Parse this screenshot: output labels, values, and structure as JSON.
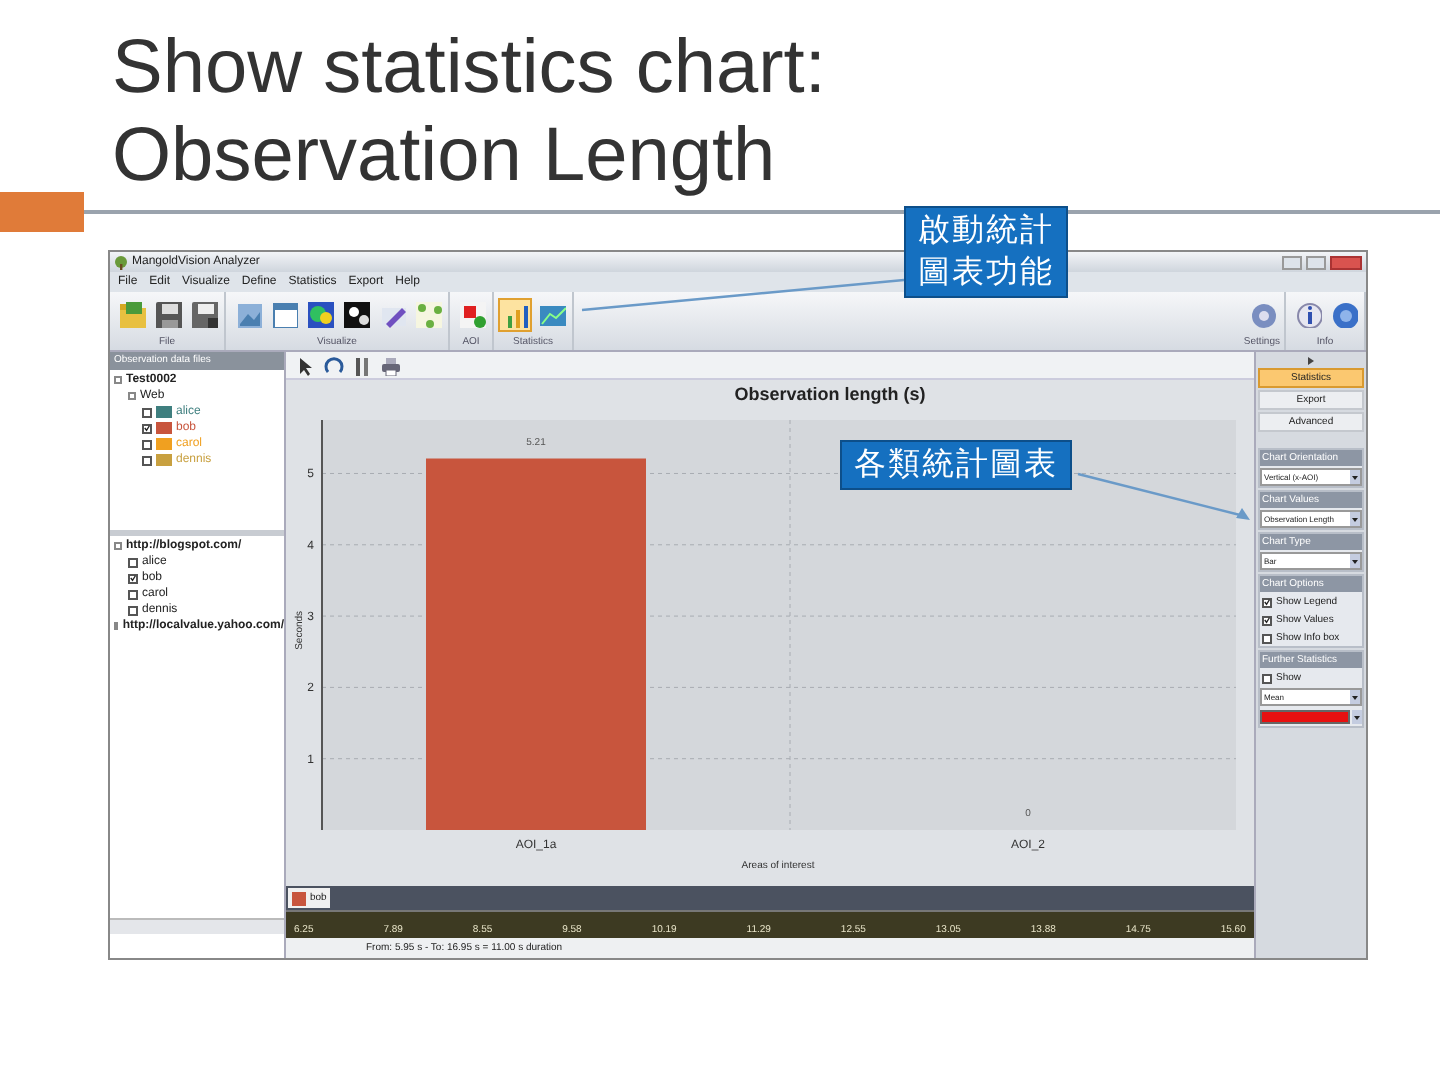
{
  "slide": {
    "title_lines": [
      "Show statistics chart:",
      "Observation Length"
    ]
  },
  "callouts": [
    {
      "text_lines": [
        "啟動統計",
        "圖表功能"
      ]
    },
    {
      "text_lines": [
        "各類統計圖表"
      ]
    }
  ],
  "window": {
    "title": "MangoldVision Analyzer"
  },
  "menu": [
    "File",
    "Edit",
    "Visualize",
    "Define",
    "Statistics",
    "Export",
    "Help"
  ],
  "ribbon": {
    "groups": [
      {
        "label": "File",
        "buttons": [
          {
            "selected": false
          },
          {
            "selected": false
          },
          {
            "selected": false
          }
        ]
      },
      {
        "label": "Visualize",
        "buttons": [
          {
            "selected": false
          },
          {
            "selected": false
          },
          {
            "selected": false
          },
          {
            "selected": false
          },
          {
            "selected": false
          },
          {
            "selected": false
          }
        ]
      },
      {
        "label": "AOI",
        "buttons": [
          {
            "selected": false
          }
        ]
      },
      {
        "label": "Statistics",
        "buttons": [
          {
            "selected": true
          },
          {
            "selected": false
          }
        ]
      }
    ],
    "right_groups": [
      {
        "label": "Settings",
        "buttons": [
          {
            "selected": false
          }
        ]
      },
      {
        "label": "Info",
        "buttons": [
          {
            "selected": false
          },
          {
            "selected": false
          }
        ]
      }
    ]
  },
  "left_panel": {
    "header": "Observation data files",
    "tree": [
      {
        "label": "Test0002",
        "children": [
          {
            "label": "Web",
            "children": [
              {
                "label": "alice",
                "checked": false,
                "color": "#3f7f7f"
              },
              {
                "label": "bob",
                "checked": true,
                "color": "#c8553d"
              },
              {
                "label": "carol",
                "checked": false,
                "color": "#f0a020"
              },
              {
                "label": "dennis",
                "checked": false,
                "color": "#c8a040"
              }
            ]
          }
        ]
      }
    ],
    "tree2": [
      {
        "label": "http://blogspot.com/",
        "children": [
          {
            "label": "alice",
            "checked": false
          },
          {
            "label": "bob",
            "checked": true
          },
          {
            "label": "carol",
            "checked": false
          },
          {
            "label": "dennis",
            "checked": false
          }
        ]
      },
      {
        "label": "http://localvalue.yahoo.com/"
      }
    ]
  },
  "chart": {
    "chart_data": {
      "type": "bar",
      "title": "Observation length (s)",
      "xlabel": "Areas of interest",
      "ylabel": "Seconds",
      "categories": [
        "AOI_1a",
        "AOI_2"
      ],
      "series": [
        {
          "name": "bob",
          "color": "#c8553d",
          "values": [
            5.21,
            0
          ]
        }
      ],
      "ylim": [
        0,
        5.75
      ],
      "grid": true,
      "yticks": [
        1,
        2,
        3,
        4,
        5
      ],
      "data_labels": true,
      "value_labels": [
        "5.21",
        "0"
      ]
    }
  },
  "timeline": {
    "ticks": [
      "6.25",
      "7.89",
      "8.55",
      "9.58",
      "10.19",
      "11.29",
      "12.55",
      "13.05",
      "13.88",
      "14.75",
      "15.60"
    ]
  },
  "status_bar": "From: 5.95 s - To: 16.95 s = 11.00 s duration",
  "right_panel": {
    "tabs": [
      {
        "label": "Statistics",
        "selected": true
      },
      {
        "label": "Export",
        "selected": false
      },
      {
        "label": "Advanced",
        "selected": false
      }
    ],
    "sections": [
      {
        "kind": "select",
        "header": "Chart Orientation",
        "value": "Vertical (x-AOI)"
      },
      {
        "kind": "select",
        "header": "Chart Values",
        "value": "Observation Length"
      },
      {
        "kind": "select",
        "header": "Chart Type",
        "value": "Bar"
      },
      {
        "kind": "checks",
        "header": "Chart Options",
        "items": [
          {
            "label": "Show Legend",
            "checked": true
          },
          {
            "label": "Show Values",
            "checked": true
          },
          {
            "label": "Show Info box",
            "checked": false
          }
        ]
      },
      {
        "kind": "further",
        "header": "Further Statistics",
        "items": [
          {
            "label": "Show",
            "checked": false
          }
        ],
        "value": "Mean",
        "color": "#e81010"
      }
    ]
  }
}
